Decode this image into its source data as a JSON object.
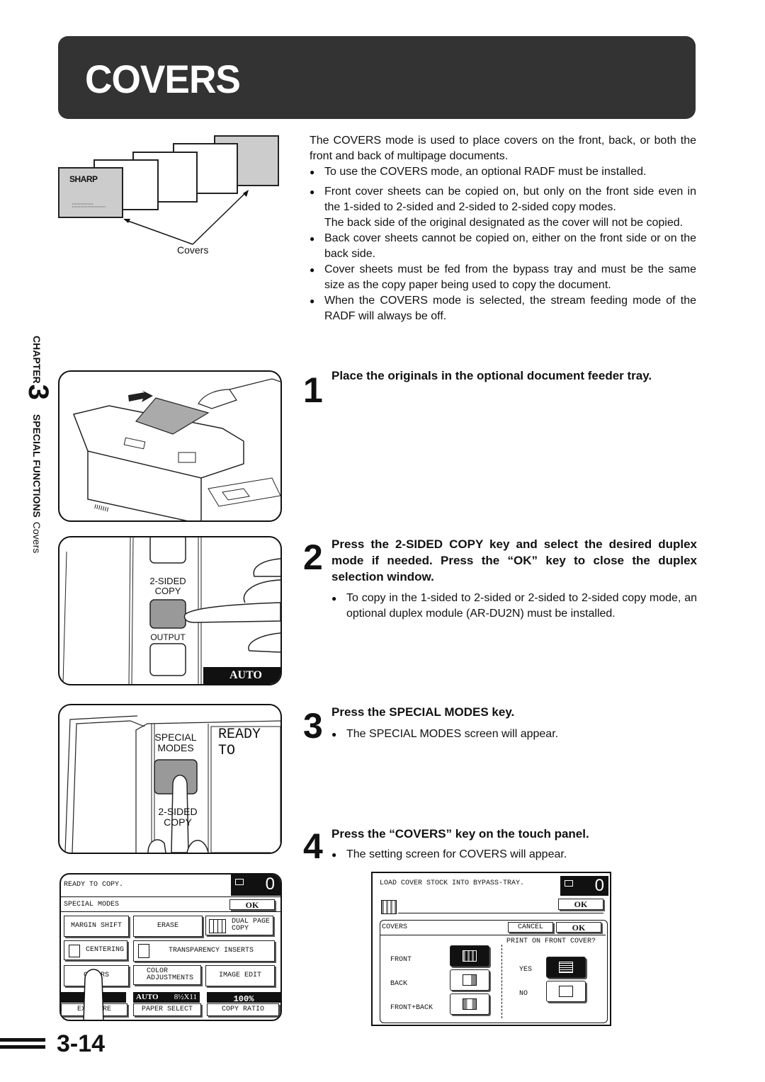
{
  "page": {
    "title": "COVERS",
    "page_number": "3-14"
  },
  "sidebar": {
    "chapter_word": "CHAPTER",
    "chapter_number": "3",
    "section": "SPECIAL FUNCTIONS",
    "subsection": "Covers"
  },
  "covers_figure": {
    "logo": "SHARP",
    "caption": "Covers"
  },
  "intro": {
    "paragraph": "The COVERS mode is used to place covers on the front, back, or both the front and back of multipage documents.",
    "bullets": [
      "To use the COVERS mode, an optional RADF must be installed.",
      "Front cover sheets can be copied on, but only on the front side even in the 1-sided to 2-sided and 2-sided to 2-sided copy modes.",
      "Back cover sheets cannot be copied on, either on the front side or on the back side.",
      "Cover sheets must be fed from the bypass tray and must be the same size as the copy paper being used to copy the document.",
      "When the COVERS mode is selected, the stream feeding mode of the RADF will always be off."
    ],
    "bullet_2_continuation": "The back side of the original designated as the cover will not be copied."
  },
  "steps": [
    {
      "number": "1",
      "heading": "Place the originals in the optional document feeder tray.",
      "bullets": []
    },
    {
      "number": "2",
      "heading": "Press the 2-SIDED COPY key and select the desired duplex mode if needed. Press the “OK” key to close the duplex selection window.",
      "bullets": [
        "To copy in the 1-sided to 2-sided or 2-sided to 2-sided copy mode, an optional duplex module (AR-DU2N) must be installed."
      ]
    },
    {
      "number": "3",
      "heading": "Press the SPECIAL MODES key.",
      "bullets": [
        "The SPECIAL MODES screen will appear."
      ]
    },
    {
      "number": "4",
      "heading": "Press the “COVERS” key on the touch panel.",
      "bullets": [
        "The setting screen for COVERS will appear."
      ]
    }
  ],
  "panel_2sided": {
    "key_label_1": "2-SIDED",
    "key_label_2": "COPY",
    "output_label": "OUTPUT",
    "status": "AUTO"
  },
  "panel_special": {
    "key_label_1": "SPECIAL",
    "key_label_2": "MODES",
    "below_label_1": "2-SIDED",
    "below_label_2": "COPY",
    "display_text": "READY TO"
  },
  "special_modes_screen": {
    "message": "READY TO COPY.",
    "copy_count": "0",
    "header": "SPECIAL MODES",
    "ok": "OK",
    "buttons": [
      {
        "label": "MARGIN SHIFT"
      },
      {
        "label": "ERASE"
      },
      {
        "label": "DUAL PAGE COPY",
        "line1": "DUAL PAGE",
        "line2": "COPY"
      },
      {
        "label": "CENTERING"
      },
      {
        "label": "TRANSPARENCY INSERTS"
      },
      {
        "label": "COVERS"
      },
      {
        "label": "COLOR ADJUSTMENTS",
        "line1": "COLOR",
        "line2": "ADJUSTMENTS"
      },
      {
        "label": "IMAGE EDIT"
      }
    ],
    "status_bar": {
      "exposure_label": "EXPOSURE",
      "paper_mode": "AUTO",
      "paper_size": "8½X11",
      "paper_select_label": "PAPER SELECT",
      "ratio": "100%",
      "ratio_label": "COPY RATIO"
    }
  },
  "covers_screen": {
    "message": "LOAD COVER STOCK INTO BYPASS-TRAY.",
    "copy_count": "0",
    "ok_top": "OK",
    "header": "COVERS",
    "cancel": "CANCEL",
    "ok": "OK",
    "options": [
      {
        "label": "FRONT",
        "selected": true
      },
      {
        "label": "BACK",
        "selected": false
      },
      {
        "label": "FRONT+BACK",
        "selected": false
      }
    ],
    "question": "PRINT ON FRONT COVER?",
    "answers": [
      {
        "label": "YES",
        "selected": true
      },
      {
        "label": "NO",
        "selected": false
      }
    ]
  }
}
